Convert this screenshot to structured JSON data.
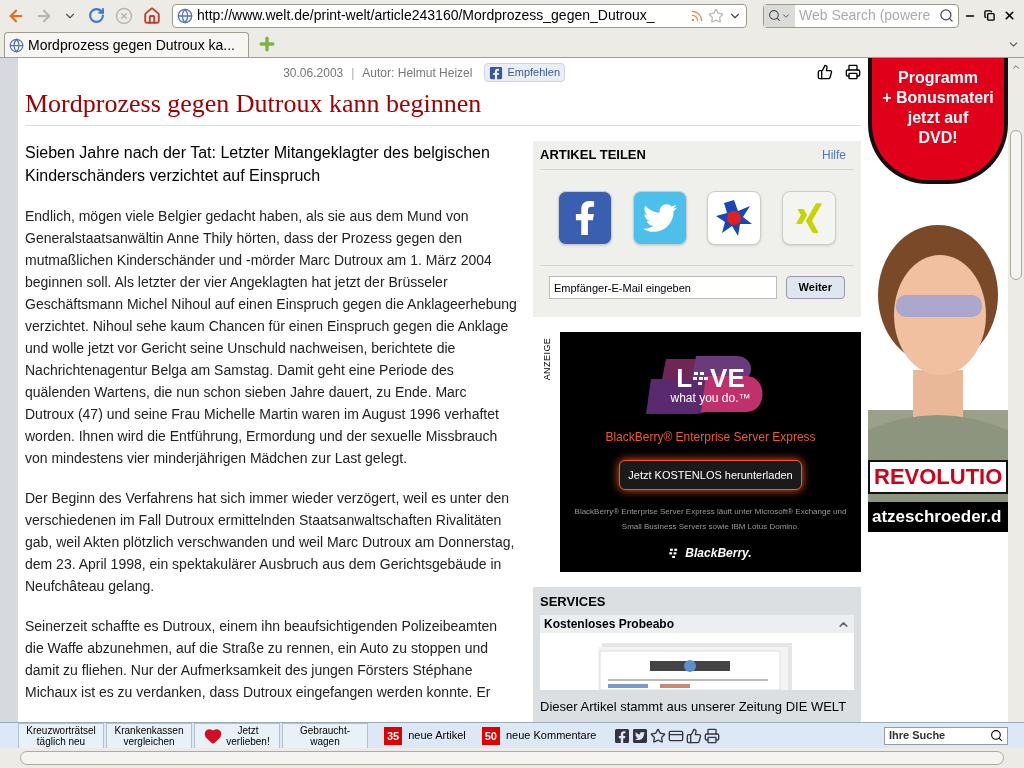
{
  "toolbar": {
    "nav_buttons": [
      {
        "kind": "back",
        "disabled": false
      },
      {
        "kind": "forward",
        "disabled": true
      },
      {
        "kind": "history",
        "disabled": false
      },
      {
        "kind": "reload",
        "disabled": false
      },
      {
        "kind": "stop",
        "disabled": true
      },
      {
        "kind": "home",
        "disabled": false
      }
    ],
    "url": "http://www.welt.de/print-welt/article243160/Mordprozess_gegen_Dutroux_",
    "search": {
      "placeholder": "Web Search (powere"
    }
  },
  "tabs": [
    {
      "label": "Mordprozess gegen Dutroux ka...",
      "selected": true
    }
  ],
  "article": {
    "date": "30.06.2003",
    "separator": "|",
    "author": "Autor: Helmut Heizel",
    "like_button": "Empfehlen",
    "title": "Mordprozess gegen Dutroux kann beginnen",
    "subtitle": "Sieben Jahre nach der Tat: Letzter Mitangeklagter des belgischen Kinderschänders verzichtet auf Einspruch",
    "paragraphs": [
      "Endlich, mögen viele Belgier gedacht haben, als sie aus dem Mund von Generalstaatsanwältin Anne Thily hörten, dass der Prozess gegen den mutmaßlichen Kinderschänder und -mörder Marc Dutroux am 1. März 2004 beginnen soll. Als letzter der vier Angeklagten hat jetzt der Brüsseler Geschäftsmann Michel Nihoul auf einen Einspruch gegen die Anklageerhebung verzichtet. Nihoul sehe kaum Chancen für einen Einspruch gegen die Anklage und wolle jetzt vor Gericht seine Unschuld nachweisen, berichtete die Nachrichtenagentur Belga am Samstag. Damit geht eine Periode des quälenden Wartens, die nun schon sieben Jahre dauert, zu Ende. Marc Dutroux (47) und seine Frau Michelle Martin waren im August 1996 verhaftet worden. Ihnen wird die Entführung, Ermordung und der sexuelle Missbrauch von mindestens vier minderjährigen Mädchen zur Last gelegt.",
      "Der Beginn des Verfahrens hat sich immer wieder verzögert, weil es unter den verschiedenen im Fall Dutroux ermittelnden Staatsanwaltschaften Rivalitäten gab, weil Akten plötzlich verschwanden und weil Marc Dutroux am Donnerstag, dem 23. April 1998, ein spektakulärer Ausbruch aus dem Gerichtsgebäude in Neufchâteau gelang.",
      "Seinerzeit schaffte es Dutroux, einem ihn beaufsichtigenden Polizeibeamten die Waffe abzunehmen, auf die Straße zu rennen, ein Auto zu stoppen und damit zu fliehen. Nur der Aufmerksamkeit des jungen Försters Stéphane Michaux ist es zu verdanken, dass Dutroux eingefangen werden konnte. Er"
    ]
  },
  "share": {
    "title": "ARTIKEL TEILEN",
    "help": "Hilfe",
    "services": [
      {
        "kind": "facebook"
      },
      {
        "kind": "twitter"
      },
      {
        "kind": "star"
      },
      {
        "kind": "xing"
      }
    ],
    "email": "Empfänger-E-Mail eingeben",
    "button": "Weiter"
  },
  "ad": {
    "label": "ANZEIGE",
    "logo": [
      "L",
      "VE"
    ],
    "tagline": "what you do.™",
    "product": "BlackBerry® Enterprise Server Express",
    "cta": "Jetzt KOSTENLOS herunterladen",
    "fine_print": "BlackBerry® Enterprise Server Express läuft unter Microsoft® Exchange und Small Business Servers sowie IBM Lotus Domino.",
    "brand": "BlackBerry."
  },
  "services": {
    "title": "SERVICES",
    "section": {
      "label": "Kostenloses Probeabo",
      "expanded": true
    },
    "teaser": "Dieser Artikel stammt aus unserer Zeitung DIE WELT"
  },
  "side_ad": {
    "badge_lines": [
      "Programm",
      "+ Bonusmateri",
      "jetzt auf",
      "DVD!"
    ],
    "banner": "REVOLUTIO",
    "site": "atzeschroeder.d"
  },
  "bottom_bar": {
    "buttons": [
      {
        "kind": "text",
        "lines": [
          "Kreuzworträtsel",
          "täglich neu"
        ]
      },
      {
        "kind": "text",
        "lines": [
          "Krankenkassen",
          "vergleichen"
        ]
      },
      {
        "kind": "heart",
        "lines": [
          "Jetzt",
          "verlieben!"
        ]
      },
      {
        "kind": "text",
        "lines": [
          "Gebraucht-",
          "wagen"
        ]
      }
    ],
    "counters": [
      {
        "count": "35",
        "label": "neue Artikel"
      },
      {
        "count": "50",
        "label": "neue Kommentare"
      }
    ],
    "icons": [
      {
        "kind": "facebook"
      },
      {
        "kind": "twitter"
      },
      {
        "kind": "star"
      },
      {
        "kind": "card"
      },
      {
        "kind": "thumb"
      },
      {
        "kind": "printer"
      }
    ],
    "search": {
      "placeholder": "Ihre Suche"
    }
  }
}
